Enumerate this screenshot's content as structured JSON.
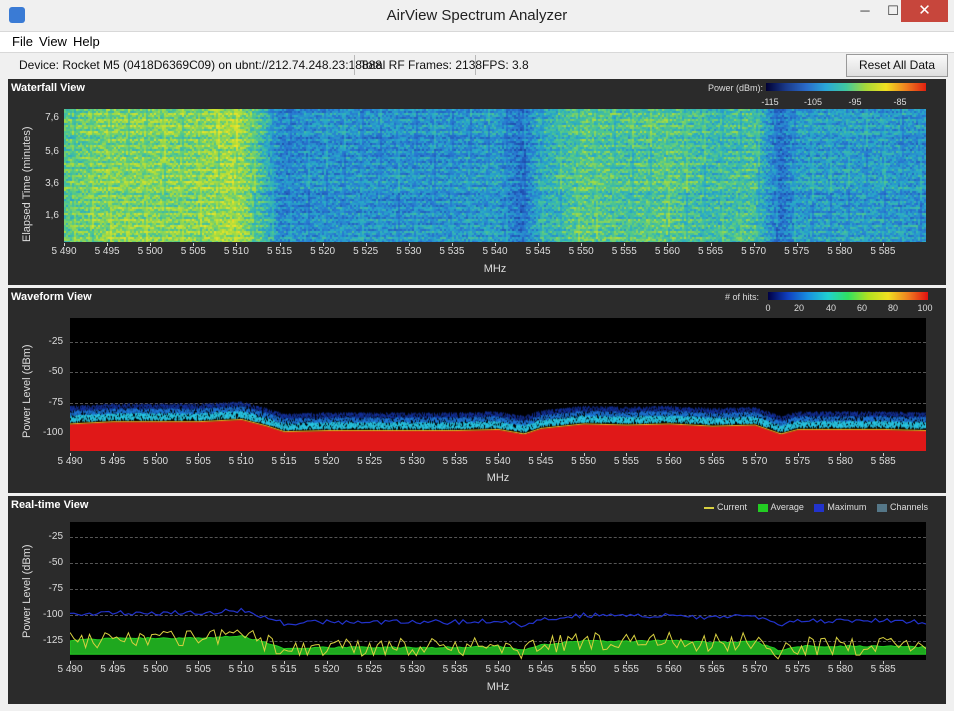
{
  "window": {
    "title": "AirView Spectrum Analyzer",
    "minimize": "─",
    "maximize": "☐",
    "close": "✕"
  },
  "menu": [
    "File",
    "View",
    "Help"
  ],
  "status": {
    "device": "Device: Rocket M5 (0418D6369C09) on ubnt://212.74.248.23:18888",
    "frames": "Total RF Frames: 2138",
    "fps": "FPS: 3.8",
    "reset_button": "Reset All Data"
  },
  "x_ticks": [
    "5 490",
    "5 495",
    "5 500",
    "5 505",
    "5 510",
    "5 515",
    "5 520",
    "5 525",
    "5 530",
    "5 535",
    "5 540",
    "5 545",
    "5 550",
    "5 555",
    "5 560",
    "5 565",
    "5 570",
    "5 575",
    "5 580",
    "5 585"
  ],
  "waterfall": {
    "title": "Waterfall View",
    "legend_label": "Power (dBm):",
    "legend_ticks": [
      "-115",
      "-105",
      "-95",
      "-85"
    ],
    "ylabel": "Elapsed Time (minutes)",
    "y_ticks": [
      "7,6",
      "5,6",
      "3,6",
      "1,6"
    ],
    "xlabel": "MHz"
  },
  "waveform": {
    "title": "Waveform View",
    "legend_label": "# of hits:",
    "legend_ticks": [
      "0",
      "20",
      "40",
      "60",
      "80",
      "100"
    ],
    "ylabel": "Power Level (dBm)",
    "y_ticks": [
      "-25",
      "-50",
      "-75",
      "-100"
    ],
    "xlabel": "MHz"
  },
  "realtime": {
    "title": "Real-time View",
    "legend": [
      {
        "label": "Current",
        "color": "#d8d040"
      },
      {
        "label": "Average",
        "color": "#22cc22"
      },
      {
        "label": "Maximum",
        "color": "#2233cc"
      },
      {
        "label": "Channels",
        "color": "#557788"
      }
    ],
    "ylabel": "Power Level (dBm)",
    "y_ticks": [
      "-25",
      "-50",
      "-75",
      "-100",
      "-125"
    ],
    "xlabel": "MHz"
  },
  "chart_data": {
    "type": "line",
    "x_range_mhz": [
      5490,
      5590
    ],
    "waterfall_ylim_minutes": [
      0,
      8
    ],
    "power_ylim_dbm": [
      -135,
      -15
    ],
    "colorscale_power_dbm": [
      -115,
      -85
    ],
    "colorscale_hits": [
      0,
      100
    ],
    "spectrum_profile": [
      {
        "mhz": 5490,
        "avg": -108
      },
      {
        "mhz": 5495,
        "avg": -106
      },
      {
        "mhz": 5500,
        "avg": -106
      },
      {
        "mhz": 5505,
        "avg": -106
      },
      {
        "mhz": 5510,
        "avg": -104
      },
      {
        "mhz": 5513,
        "avg": -110
      },
      {
        "mhz": 5515,
        "avg": -115
      },
      {
        "mhz": 5520,
        "avg": -114
      },
      {
        "mhz": 5525,
        "avg": -114
      },
      {
        "mhz": 5530,
        "avg": -114
      },
      {
        "mhz": 5535,
        "avg": -114
      },
      {
        "mhz": 5540,
        "avg": -113
      },
      {
        "mhz": 5543,
        "avg": -117
      },
      {
        "mhz": 5545,
        "avg": -112
      },
      {
        "mhz": 5550,
        "avg": -108
      },
      {
        "mhz": 5555,
        "avg": -109
      },
      {
        "mhz": 5560,
        "avg": -108
      },
      {
        "mhz": 5565,
        "avg": -110
      },
      {
        "mhz": 5570,
        "avg": -109
      },
      {
        "mhz": 5573,
        "avg": -117
      },
      {
        "mhz": 5575,
        "avg": -113
      },
      {
        "mhz": 5580,
        "avg": -113
      },
      {
        "mhz": 5585,
        "avg": -113
      },
      {
        "mhz": 5590,
        "avg": -114
      }
    ]
  }
}
